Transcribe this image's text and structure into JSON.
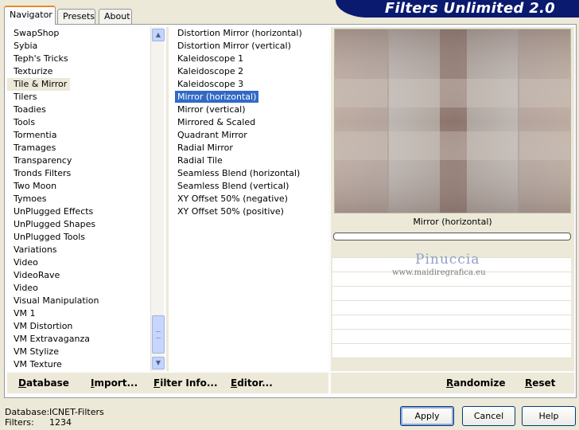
{
  "tabs": [
    {
      "label": "Navigator",
      "active": true
    },
    {
      "label": "Presets",
      "active": false
    },
    {
      "label": "About",
      "active": false
    }
  ],
  "banner": {
    "title": "Filters Unlimited 2.0",
    "color": "#0a1a6e"
  },
  "categories": [
    "SwapShop",
    "Sybia",
    "Teph's Tricks",
    "Texturize",
    "Tile & Mirror",
    "Tilers",
    "Toadies",
    "Tools",
    "Tormentia",
    "Tramages",
    "Transparency",
    "Tronds Filters",
    "Two Moon",
    "Tymoes",
    "UnPlugged Effects",
    "UnPlugged Shapes",
    "UnPlugged Tools",
    "Variations",
    "Video",
    "VideoRave",
    "Video",
    "Visual Manipulation",
    "VM 1",
    "VM Distortion",
    "VM Extravaganza",
    "VM Stylize",
    "VM Texture"
  ],
  "selected_category": "Tile & Mirror",
  "filters": [
    "Distortion Mirror (horizontal)",
    "Distortion Mirror (vertical)",
    "Kaleidoscope 1",
    "Kaleidoscope 2",
    "Kaleidoscope 3",
    "Mirror (horizontal)",
    "Mirror (vertical)",
    "Mirrored & Scaled",
    "Quadrant Mirror",
    "Radial Mirror",
    "Radial Tile",
    "Seamless Blend (horizontal)",
    "Seamless Blend (vertical)",
    "XY Offset 50% (negative)",
    "XY Offset 50% (positive)"
  ],
  "selected_filter": "Mirror (horizontal)",
  "preview": {
    "filter_name": "Mirror (horizontal)",
    "progress": 0
  },
  "watermark": {
    "line1": "Pinuccia",
    "line2": "www.maidiregrafica.eu"
  },
  "bottom_buttons": {
    "database": "Database",
    "import": "Import...",
    "filter_info": "Filter Info...",
    "editor": "Editor...",
    "randomize": "Randomize",
    "reset": "Reset"
  },
  "db_info": {
    "database_label": "Database:",
    "database_value": "ICNET-Filters",
    "filters_label": "Filters:",
    "filters_value": "1234"
  },
  "dialog_buttons": {
    "apply": "Apply",
    "cancel": "Cancel",
    "help": "Help"
  },
  "colors": {
    "selection": "#316ac5",
    "tab_accent": "#e68b2c",
    "dialog_bg": "#ece9d8"
  }
}
